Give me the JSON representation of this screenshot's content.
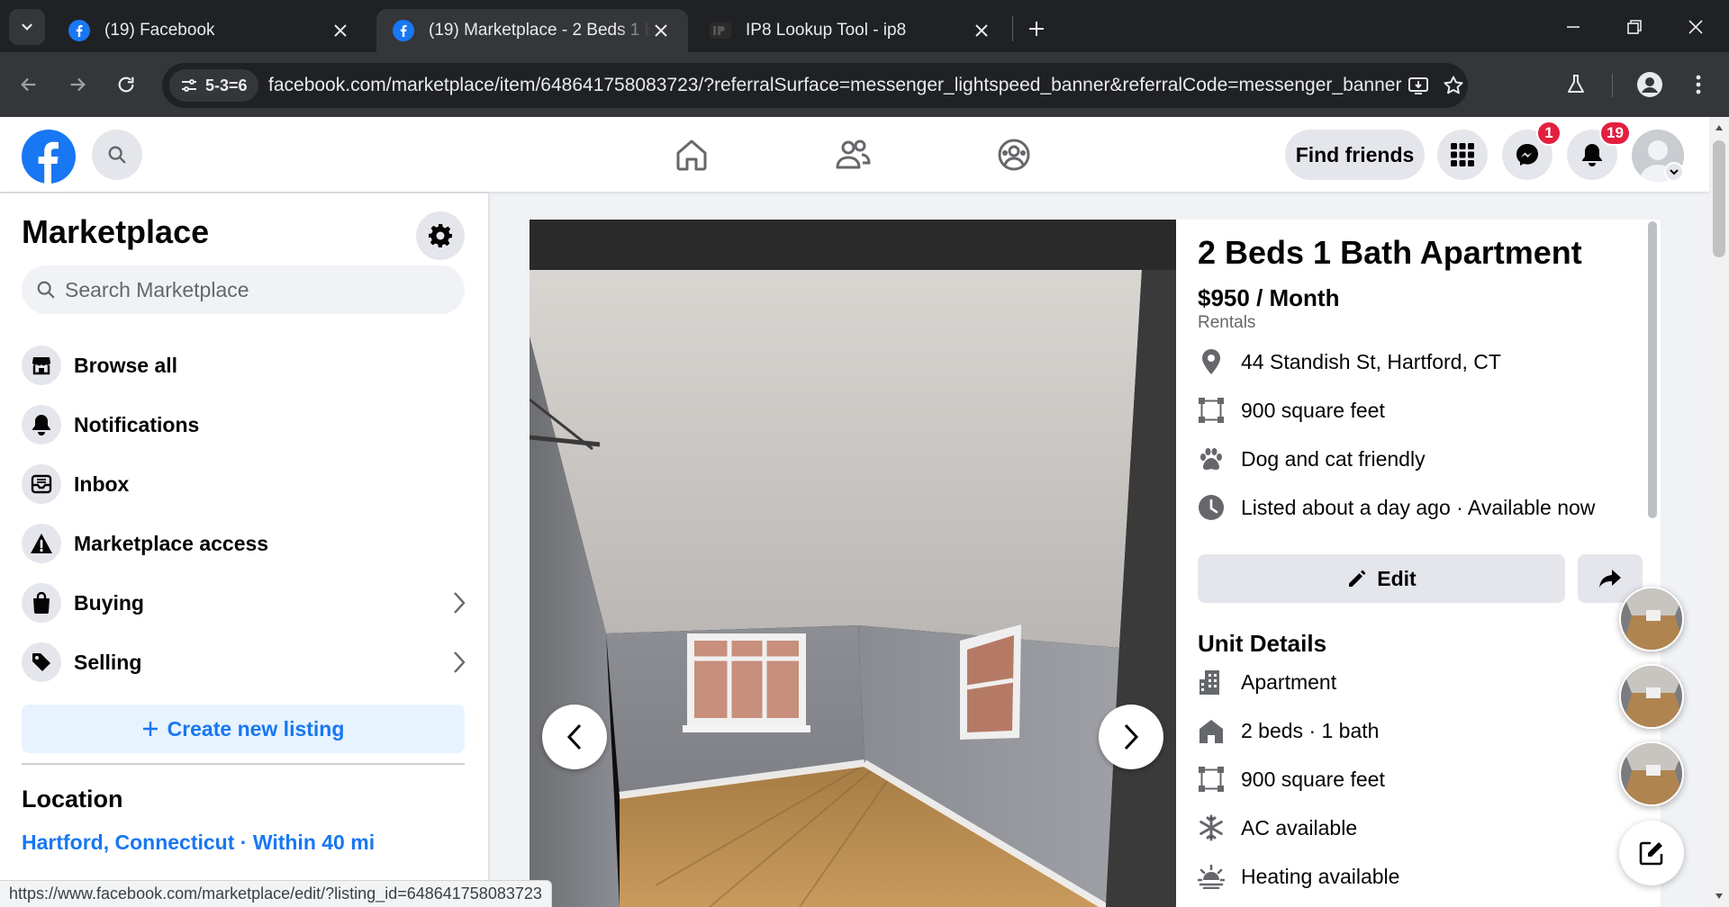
{
  "browser": {
    "tabs": [
      {
        "title": "(19) Facebook",
        "active": false
      },
      {
        "title": "(19) Marketplace - 2 Beds 1 Bath",
        "active": true
      },
      {
        "title": "IP8 Lookup Tool - ip8",
        "active": false
      }
    ],
    "site_chip": "5-3=6",
    "url": "facebook.com/marketplace/item/648641758083723/?referralSurface=messenger_lightspeed_banner&referralCode=messenger_banner",
    "status_url": "https://www.facebook.com/marketplace/edit/?listing_id=648641758083723"
  },
  "header": {
    "find_friends": "Find friends",
    "messenger_badge": "1",
    "notifications_badge": "19"
  },
  "sidebar": {
    "title": "Marketplace",
    "search_placeholder": "Search Marketplace",
    "items": [
      {
        "label": "Browse all",
        "icon": "storefront-icon"
      },
      {
        "label": "Notifications",
        "icon": "bell-icon"
      },
      {
        "label": "Inbox",
        "icon": "inbox-icon"
      },
      {
        "label": "Marketplace access",
        "icon": "warning-icon"
      },
      {
        "label": "Buying",
        "icon": "bag-icon"
      },
      {
        "label": "Selling",
        "icon": "tag-icon"
      }
    ],
    "create_listing": "Create new listing",
    "location_title": "Location",
    "location_value": "Hartford, Connecticut · Within 40 mi"
  },
  "listing": {
    "title": "2 Beds 1 Bath Apartment",
    "price": "$950 / Month",
    "category": "Rentals",
    "facts": [
      {
        "icon": "location-pin-icon",
        "text": "44 Standish St, Hartford, CT"
      },
      {
        "icon": "area-icon",
        "text": "900 square feet"
      },
      {
        "icon": "paw-icon",
        "text": "Dog and cat friendly"
      },
      {
        "icon": "clock-icon",
        "text": "Listed about a day ago · Available now"
      }
    ],
    "edit_label": "Edit",
    "unit_details_title": "Unit Details",
    "unit_details": [
      {
        "icon": "building-icon",
        "text": "Apartment"
      },
      {
        "icon": "home-icon",
        "text": "2 beds · 1 bath"
      },
      {
        "icon": "area-icon",
        "text": "900 square feet"
      },
      {
        "icon": "snowflake-icon",
        "text": "AC available"
      },
      {
        "icon": "heat-icon",
        "text": "Heating available"
      }
    ]
  },
  "colors": {
    "brand": "#1877f2",
    "badge": "#e41e3f"
  }
}
